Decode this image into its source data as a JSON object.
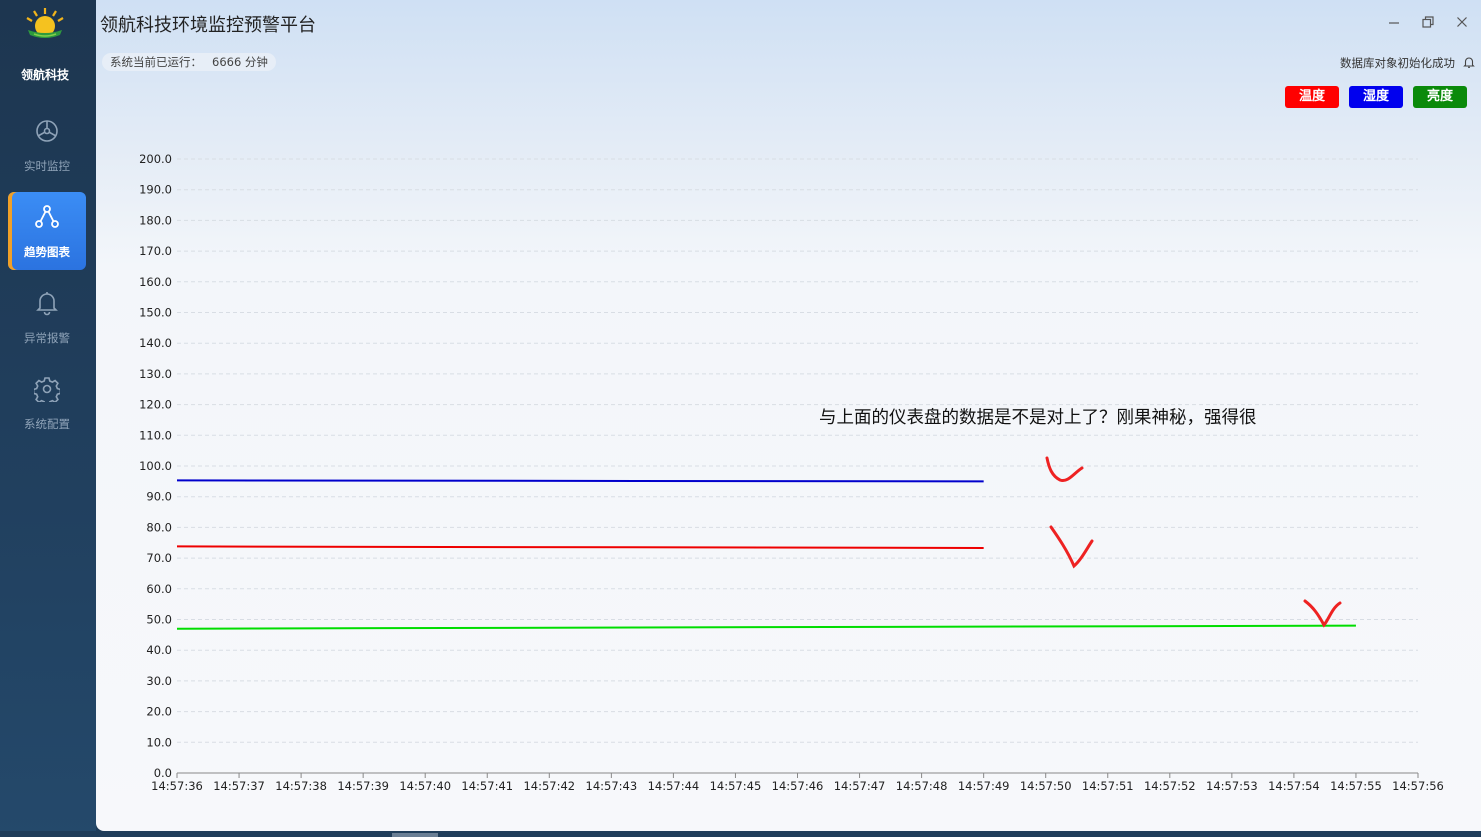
{
  "app": {
    "title": "领航科技环境监控预警平台",
    "brand": "领航科技"
  },
  "sidebar": {
    "items": [
      {
        "label": "实时监控",
        "icon": "dashboard-icon",
        "active": false
      },
      {
        "label": "趋势图表",
        "icon": "graph-nodes-icon",
        "active": true
      },
      {
        "label": "异常报警",
        "icon": "bell-icon",
        "active": false
      },
      {
        "label": "系统配置",
        "icon": "gear-icon",
        "active": false
      }
    ]
  },
  "status": {
    "run_label": "系统当前已运行：",
    "run_value": "6666 分钟",
    "db_message": "数据库对象初始化成功"
  },
  "legend": [
    {
      "label": "温度",
      "color": "#ff0000"
    },
    {
      "label": "湿度",
      "color": "#0000ee"
    },
    {
      "label": "亮度",
      "color": "#008000"
    }
  ],
  "annotation": "与上面的仪表盘的数据是不是对上了？刚果神秘，强得很",
  "chart_data": {
    "type": "line",
    "title": "",
    "xlabel": "",
    "ylabel": "",
    "ylim": [
      0,
      200
    ],
    "y_ticks": [
      "0.0",
      "10.0",
      "20.0",
      "30.0",
      "40.0",
      "50.0",
      "60.0",
      "70.0",
      "80.0",
      "90.0",
      "100.0",
      "110.0",
      "120.0",
      "130.0",
      "140.0",
      "150.0",
      "160.0",
      "170.0",
      "180.0",
      "190.0",
      "200.0"
    ],
    "x": [
      "14:57:36",
      "14:57:37",
      "14:57:38",
      "14:57:39",
      "14:57:40",
      "14:57:41",
      "14:57:42",
      "14:57:43",
      "14:57:44",
      "14:57:45",
      "14:57:46",
      "14:57:47",
      "14:57:48",
      "14:57:49",
      "14:57:50",
      "14:57:51",
      "14:57:52",
      "14:57:53",
      "14:57:54",
      "14:57:55",
      "14:57:56"
    ],
    "grid": true,
    "series": [
      {
        "name": "湿度",
        "color": "#0000cc",
        "x_start": 0,
        "x_end": 13.0,
        "values": [
          95.3,
          95.0
        ]
      },
      {
        "name": "温度",
        "color": "#ee0000",
        "x_start": 0,
        "x_end": 13.0,
        "values": [
          73.8,
          73.3
        ]
      },
      {
        "name": "亮度",
        "color": "#00dd00",
        "x_start": 0,
        "x_end": 19.0,
        "values": [
          47.0,
          48.0
        ]
      }
    ]
  }
}
